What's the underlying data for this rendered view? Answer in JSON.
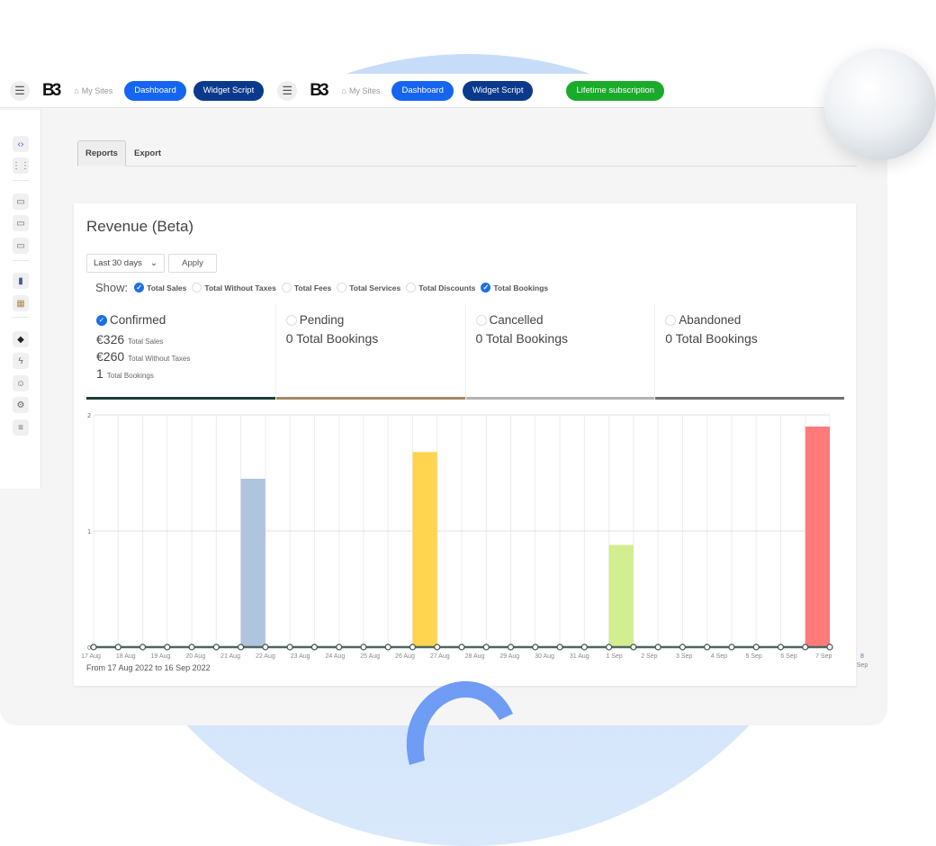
{
  "topbar": {
    "groups": [
      {
        "logo": "B3",
        "my_sites": "My Sites",
        "dashboard": "Dashboard",
        "widget_script": "Widget Script"
      },
      {
        "logo": "B3",
        "my_sites": "My Sites",
        "dashboard": "Dashboard",
        "widget_script": "Widget Script"
      }
    ],
    "lifetime": "Lifetime subscription",
    "colors": {
      "dashboard": "#1565f0",
      "widget": "#0b3a8c",
      "lifetime": "#1aab2a"
    }
  },
  "sidebar": {
    "icons": [
      "code-icon",
      "grid-icon",
      "image-icon",
      "window-icon",
      "comment-icon",
      "phone-icon",
      "calendar-icon",
      "paint-bucket-icon",
      "lightning-icon",
      "users-icon",
      "gear-icon",
      "sliders-icon"
    ]
  },
  "tabs": [
    {
      "label": "Reports",
      "active": true
    },
    {
      "label": "Export",
      "active": false
    }
  ],
  "card": {
    "title": "Revenue (Beta)",
    "range_select": "Last 30 days",
    "apply": "Apply",
    "show_label": "Show:",
    "show_options": [
      {
        "label": "Total Sales",
        "checked": true
      },
      {
        "label": "Total Without Taxes",
        "checked": false
      },
      {
        "label": "Total Fees",
        "checked": false
      },
      {
        "label": "Total Services",
        "checked": false
      },
      {
        "label": "Total Discounts",
        "checked": false
      },
      {
        "label": "Total Bookings",
        "checked": true
      }
    ],
    "statuses": [
      {
        "label": "Confirmed",
        "checked": true,
        "color": "#1d3d35",
        "lines": [
          {
            "value": "€326",
            "label": "Total Sales"
          },
          {
            "value": "€260",
            "label": "Total Without Taxes"
          },
          {
            "value": "1",
            "label": "Total Bookings"
          }
        ]
      },
      {
        "label": "Pending",
        "checked": false,
        "color": "#a38a66",
        "summary": "0 Total Bookings"
      },
      {
        "label": "Cancelled",
        "checked": false,
        "color": "#b3b3b3",
        "summary": "0 Total Bookings"
      },
      {
        "label": "Abandoned",
        "checked": false,
        "color": "#6e6e6e",
        "summary": "0 Total Bookings"
      }
    ],
    "range_text": "From 17 Aug 2022 to 16 Sep 2022"
  },
  "chart_data": {
    "type": "bar",
    "x_tick_labels": [
      "17 Aug",
      "18 Aug",
      "19 Aug",
      "20 Aug",
      "21 Aug",
      "22 Aug",
      "23 Aug",
      "24 Aug",
      "25 Aug",
      "26 Aug",
      "27 Aug",
      "28 Aug",
      "29 Aug",
      "30 Aug",
      "31 Aug",
      "1 Sep",
      "2 Sep",
      "3 Sep",
      "4 Sep",
      "5 Sep",
      "6 Sep",
      "7 Sep",
      "8 Sep"
    ],
    "y_ticks": [
      0,
      1,
      2
    ],
    "ylim": [
      0,
      2
    ],
    "grid": true,
    "points_on_baseline": 31,
    "bars": [
      {
        "near": "21 Aug",
        "value": 1.45,
        "color": "#b0c4de"
      },
      {
        "near": "26 Aug",
        "value": 1.68,
        "color": "#ffd54f"
      },
      {
        "near": "1 Sep",
        "value": 0.88,
        "color": "#d2ee90"
      },
      {
        "near": "7 Sep",
        "value": 1.9,
        "color": "#ff7b7b"
      }
    ]
  }
}
